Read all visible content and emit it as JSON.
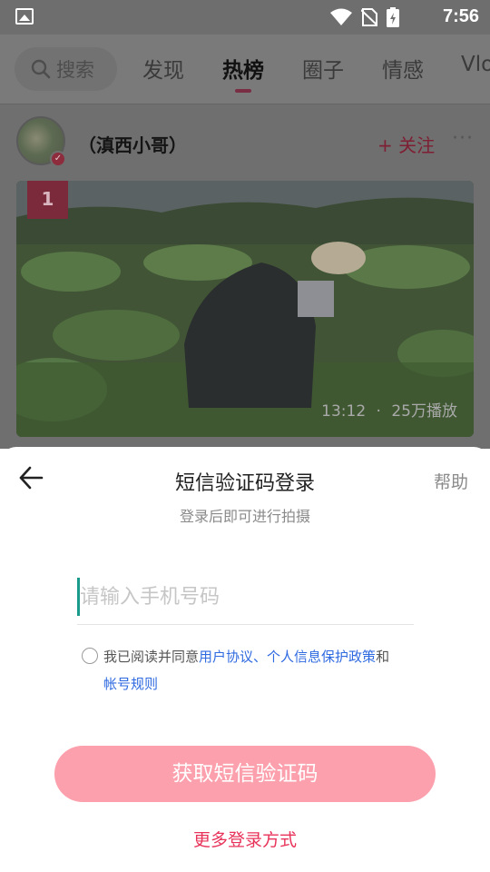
{
  "status_bar": {
    "time": "7:56",
    "icons": [
      "gallery-icon",
      "wifi-icon",
      "no-sim-icon",
      "battery-icon"
    ]
  },
  "header": {
    "search_label": "搜索",
    "tabs": [
      {
        "label": "发现",
        "active": false
      },
      {
        "label": "热榜",
        "active": true
      },
      {
        "label": "圈子",
        "active": false
      },
      {
        "label": "情感",
        "active": false
      },
      {
        "label": "Vlo",
        "active": false
      }
    ]
  },
  "feed": {
    "author_name": "（滇西小哥）",
    "follow_label": "+ 关注",
    "more_label": "···",
    "rank": "1",
    "duration": "13:12",
    "separator": "·",
    "plays": "25万播放"
  },
  "login_sheet": {
    "title": "短信验证码登录",
    "help_label": "帮助",
    "subtitle": "登录后即可进行拍摄",
    "phone_placeholder": "请输入手机号码",
    "agreement_prefix": "我已阅读并同意",
    "user_agreement": "用户协议",
    "comma": "、",
    "privacy_policy": "个人信息保护政策",
    "and": "和",
    "account_rules": "帐号规则",
    "sms_button": "获取短信验证码",
    "more_login": "更多登录方式"
  },
  "colors": {
    "accent_pink": "#fba0ac",
    "link_blue": "#2f6ae0",
    "more_login_red": "#e8335a",
    "caret_teal": "#1a9a8a"
  }
}
